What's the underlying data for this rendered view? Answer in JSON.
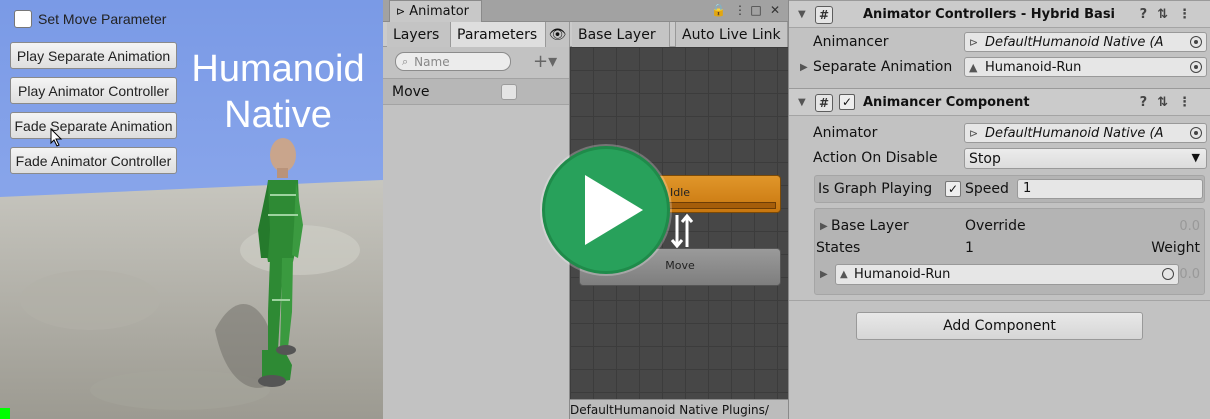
{
  "game": {
    "toggle_label": "Set Move Parameter",
    "buttons": [
      "Play Separate Animation",
      "Play Animator Controller",
      "Fade Separate Animation",
      "Fade Animator Controller"
    ],
    "title_line1": "Humanoid",
    "title_line2": "Native"
  },
  "animator": {
    "window_title": "Animator",
    "tabs": {
      "layers": "Layers",
      "parameters": "Parameters"
    },
    "breadcrumb": "Base Layer",
    "auto_live_link": "Auto Live Link",
    "search_placeholder": "Name",
    "parameter": {
      "name": "Move",
      "value": false
    },
    "states": {
      "idle": "Idle",
      "move": "Move"
    },
    "status_path": "DefaultHumanoid Native Plugins/"
  },
  "inspector": {
    "controllers_title": "Animator Controllers - Hybrid Basi",
    "animancer_label": "Animancer",
    "animancer_value": "DefaultHumanoid Native (A",
    "separate_label": "Separate Animation",
    "separate_value": "Humanoid-Run",
    "component_title": "Animancer Component",
    "animator_label": "Animator",
    "animator_value": "DefaultHumanoid Native (A",
    "action_label": "Action On Disable",
    "action_value": "Stop",
    "graph_playing_label": "Is Graph Playing",
    "speed_label": "Speed",
    "speed_value": "1",
    "base_layer_label": "Base Layer",
    "base_layer_mode": "Override",
    "base_layer_weight": "0.0",
    "states_label": "States",
    "states_count": "1",
    "weight_label": "Weight",
    "state_name": "Humanoid-Run",
    "state_weight": "0.0",
    "add_component": "Add Component"
  },
  "colors": {
    "accent_play": "#28a15b",
    "idle_state": "#d4841c",
    "sky": "#7a9ae6",
    "character": "#2e8a34"
  }
}
